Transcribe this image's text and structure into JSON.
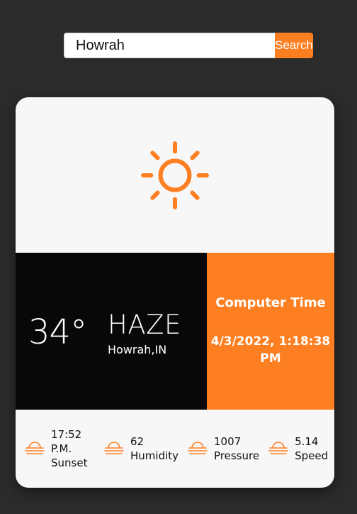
{
  "search": {
    "value": "Howrah",
    "placeholder": "",
    "button_label": "Search"
  },
  "weather": {
    "icon": "sun-icon",
    "temperature": "34°",
    "condition": "HAZE",
    "location": "Howrah,IN"
  },
  "clock": {
    "title": "Computer Time",
    "value": "4/3/2022, 1:18:38 PM"
  },
  "stats": [
    {
      "icon": "haze-icon",
      "value": "17:52 P.M.",
      "label": "Sunset"
    },
    {
      "icon": "haze-icon",
      "value": "62",
      "label": "Humidity"
    },
    {
      "icon": "haze-icon",
      "value": "1007",
      "label": "Pressure"
    },
    {
      "icon": "haze-icon",
      "value": "5.14",
      "label": "Speed"
    }
  ],
  "colors": {
    "background": "#2b2b2b",
    "accent": "#fd7f21",
    "card": "#f7f7f7",
    "dark_panel": "#080808"
  }
}
